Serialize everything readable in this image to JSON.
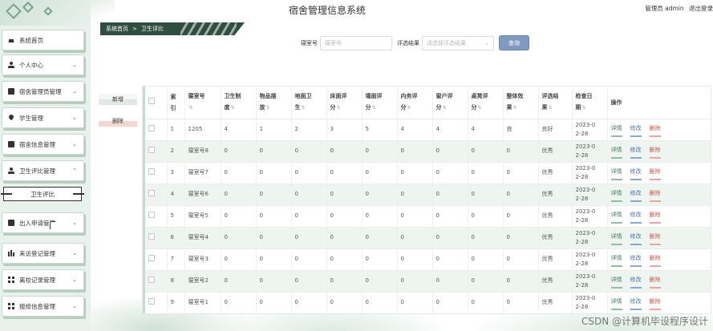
{
  "header": {
    "site_title": "宿舍管理信息系统",
    "admin_label": "管理员 admin",
    "logout_label": "退出登录"
  },
  "breadcrumb": {
    "home": "系统首页",
    "separator": ">",
    "current": "卫生评比"
  },
  "search": {
    "room_label": "寝室号",
    "room_placeholder": "寝室号",
    "result_label": "评选结果",
    "result_placeholder": "请选择评选结果",
    "query_button": "查询"
  },
  "actions": {
    "add": "新增",
    "delete": "删除"
  },
  "sidebar": {
    "items": [
      {
        "label": "系统首页",
        "icon": "home-icon"
      },
      {
        "label": "个人中心",
        "icon": "user-icon"
      },
      {
        "label": "宿舍管理员管理",
        "icon": "bed-icon"
      },
      {
        "label": "学生管理",
        "icon": "pin-icon"
      },
      {
        "label": "宿舍信息管理",
        "icon": "building-icon"
      },
      {
        "label": "卫生评比管理",
        "icon": "user-icon"
      },
      {
        "label": "出入申请管理",
        "icon": "clipboard-icon"
      },
      {
        "label": "来访登记管理",
        "icon": "chart-icon"
      },
      {
        "label": "离校记录管理",
        "icon": "grid-icon"
      },
      {
        "label": "报修信息管理",
        "icon": "grid-icon"
      }
    ],
    "active_sub": "卫生评比"
  },
  "table": {
    "headers": [
      "",
      "索引",
      "寝室号",
      "卫生制度",
      "物品摆放",
      "地面卫生",
      "床面评分",
      "墙面评分",
      "内务评分",
      "窗户评分",
      "桌凳评分",
      "整体效果",
      "评选结果",
      "检查日期",
      "操作"
    ],
    "header_lines": [
      [
        "",
        ""
      ],
      [
        "索",
        "引"
      ],
      [
        "寝室号",
        ""
      ],
      [
        "卫生制",
        "度"
      ],
      [
        "物品摆",
        "放"
      ],
      [
        "地面卫",
        "生"
      ],
      [
        "床面评",
        "分"
      ],
      [
        "墙面评",
        "分"
      ],
      [
        "内务评",
        "分"
      ],
      [
        "窗户评",
        "分"
      ],
      [
        "桌凳评",
        "分"
      ],
      [
        "整体效",
        "果"
      ],
      [
        "评选结",
        "果"
      ],
      [
        "检查日",
        "期"
      ],
      [
        "操作",
        ""
      ]
    ],
    "sortable": [
      false,
      false,
      true,
      true,
      true,
      true,
      true,
      true,
      true,
      true,
      true,
      true,
      true,
      true,
      false
    ],
    "op_labels": {
      "detail": "详情",
      "edit": "修改",
      "delete": "删除"
    },
    "rows": [
      {
        "index": "1",
        "room": "1205",
        "rule": "4",
        "items": "1",
        "floor": "2",
        "bed": "3",
        "wall": "5",
        "inner": "4",
        "window": "4",
        "desk": "4",
        "overall": "良",
        "result": "良好",
        "date_a": "2023-0",
        "date_b": "2-28"
      },
      {
        "index": "2",
        "room": "寝室号8",
        "rule": "0",
        "items": "0",
        "floor": "0",
        "bed": "0",
        "wall": "0",
        "inner": "0",
        "window": "0",
        "desk": "0",
        "overall": "0",
        "result": "优秀",
        "date_a": "2023-0",
        "date_b": "2-28"
      },
      {
        "index": "3",
        "room": "寝室号7",
        "rule": "0",
        "items": "0",
        "floor": "0",
        "bed": "0",
        "wall": "0",
        "inner": "0",
        "window": "0",
        "desk": "0",
        "overall": "0",
        "result": "优秀",
        "date_a": "2023-0",
        "date_b": "2-28"
      },
      {
        "index": "4",
        "room": "寝室号6",
        "rule": "0",
        "items": "0",
        "floor": "0",
        "bed": "0",
        "wall": "0",
        "inner": "0",
        "window": "0",
        "desk": "0",
        "overall": "0",
        "result": "优秀",
        "date_a": "2023-0",
        "date_b": "2-28"
      },
      {
        "index": "5",
        "room": "寝室号5",
        "rule": "0",
        "items": "0",
        "floor": "0",
        "bed": "0",
        "wall": "0",
        "inner": "0",
        "window": "0",
        "desk": "0",
        "overall": "0",
        "result": "优秀",
        "date_a": "2023-0",
        "date_b": "2-28"
      },
      {
        "index": "6",
        "room": "寝室号4",
        "rule": "0",
        "items": "0",
        "floor": "0",
        "bed": "0",
        "wall": "0",
        "inner": "0",
        "window": "0",
        "desk": "0",
        "overall": "0",
        "result": "优秀",
        "date_a": "2023-0",
        "date_b": "2-28"
      },
      {
        "index": "7",
        "room": "寝室号3",
        "rule": "0",
        "items": "0",
        "floor": "0",
        "bed": "0",
        "wall": "0",
        "inner": "0",
        "window": "0",
        "desk": "0",
        "overall": "0",
        "result": "优秀",
        "date_a": "2023-0",
        "date_b": "2-28"
      },
      {
        "index": "8",
        "room": "寝室号2",
        "rule": "0",
        "items": "0",
        "floor": "0",
        "bed": "0",
        "wall": "0",
        "inner": "0",
        "window": "0",
        "desk": "0",
        "overall": "0",
        "result": "优秀",
        "date_a": "2023-0",
        "date_b": "2-28"
      },
      {
        "index": "9",
        "room": "寝室号1",
        "rule": "0",
        "items": "0",
        "floor": "0",
        "bed": "0",
        "wall": "0",
        "inner": "0",
        "window": "0",
        "desk": "0",
        "overall": "0",
        "result": "优秀",
        "date_a": "2023-0",
        "date_b": "2-28"
      }
    ]
  },
  "watermark": "CSDN @计算机毕设程序设计",
  "colors": {
    "sidebar_bg": "#e9f1ec",
    "breadcrumb_bg": "#2f4d41",
    "row_alt": "#eef5f0",
    "query_button": "#7f9bbf",
    "delete_link": "#d2564c",
    "edit_link": "#4a6fa8",
    "detail_link": "#3a7a5a"
  }
}
